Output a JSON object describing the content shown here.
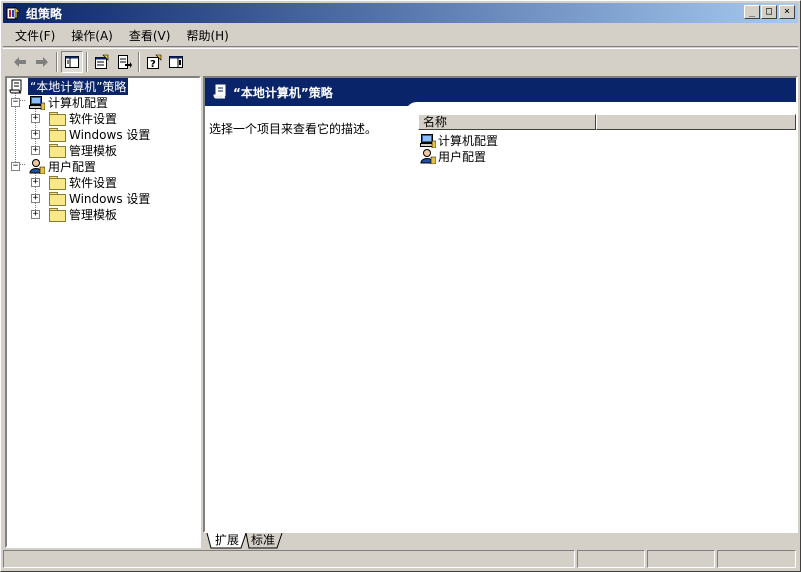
{
  "window": {
    "title": "组策略",
    "minimize": "_",
    "maximize": "□",
    "close": "×"
  },
  "menu": {
    "items": [
      "文件(F)",
      "操作(A)",
      "查看(V)",
      "帮助(H)"
    ]
  },
  "toolbar": {
    "icons": [
      "back-arrow-icon",
      "forward-arrow-icon",
      "show-hide-tree-icon",
      "properties-icon",
      "export-list-icon",
      "help-icon",
      "show-hide-action-pane-icon"
    ]
  },
  "tree": {
    "root": "“本地计算机”策略",
    "computer_config": "计算机配置",
    "user_config": "用户配置",
    "children": {
      "software": "软件设置",
      "windows": "Windows 设置",
      "templates": "管理模板"
    }
  },
  "right": {
    "header_title": "“本地计算机”策略",
    "description": "选择一个项目来查看它的描述。",
    "column_name": "名称",
    "rows": [
      "计算机配置",
      "用户配置"
    ]
  },
  "tabs": {
    "extended": "扩展",
    "standard": "标准"
  },
  "colors": {
    "title_gradient_start": "#0a246a",
    "title_gradient_end": "#a6caf0",
    "selection": "#0a246a",
    "face": "#d4d0c8"
  }
}
